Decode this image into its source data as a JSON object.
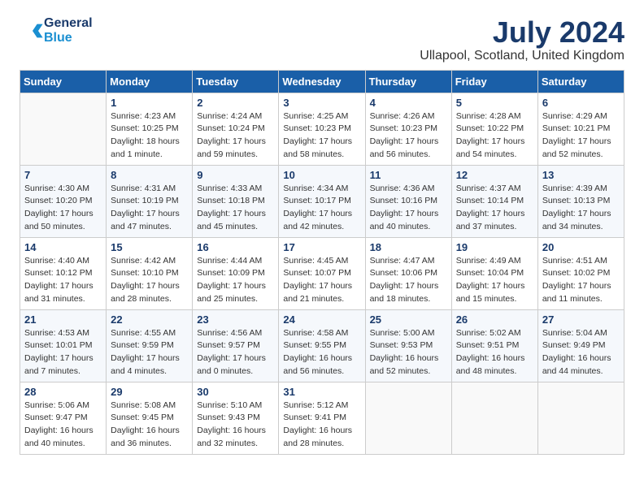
{
  "header": {
    "logo_general": "General",
    "logo_blue": "Blue",
    "month_title": "July 2024",
    "location": "Ullapool, Scotland, United Kingdom"
  },
  "days_of_week": [
    "Sunday",
    "Monday",
    "Tuesday",
    "Wednesday",
    "Thursday",
    "Friday",
    "Saturday"
  ],
  "weeks": [
    [
      {
        "day": "",
        "info": ""
      },
      {
        "day": "1",
        "info": "Sunrise: 4:23 AM\nSunset: 10:25 PM\nDaylight: 18 hours\nand 1 minute."
      },
      {
        "day": "2",
        "info": "Sunrise: 4:24 AM\nSunset: 10:24 PM\nDaylight: 17 hours\nand 59 minutes."
      },
      {
        "day": "3",
        "info": "Sunrise: 4:25 AM\nSunset: 10:23 PM\nDaylight: 17 hours\nand 58 minutes."
      },
      {
        "day": "4",
        "info": "Sunrise: 4:26 AM\nSunset: 10:23 PM\nDaylight: 17 hours\nand 56 minutes."
      },
      {
        "day": "5",
        "info": "Sunrise: 4:28 AM\nSunset: 10:22 PM\nDaylight: 17 hours\nand 54 minutes."
      },
      {
        "day": "6",
        "info": "Sunrise: 4:29 AM\nSunset: 10:21 PM\nDaylight: 17 hours\nand 52 minutes."
      }
    ],
    [
      {
        "day": "7",
        "info": "Sunrise: 4:30 AM\nSunset: 10:20 PM\nDaylight: 17 hours\nand 50 minutes."
      },
      {
        "day": "8",
        "info": "Sunrise: 4:31 AM\nSunset: 10:19 PM\nDaylight: 17 hours\nand 47 minutes."
      },
      {
        "day": "9",
        "info": "Sunrise: 4:33 AM\nSunset: 10:18 PM\nDaylight: 17 hours\nand 45 minutes."
      },
      {
        "day": "10",
        "info": "Sunrise: 4:34 AM\nSunset: 10:17 PM\nDaylight: 17 hours\nand 42 minutes."
      },
      {
        "day": "11",
        "info": "Sunrise: 4:36 AM\nSunset: 10:16 PM\nDaylight: 17 hours\nand 40 minutes."
      },
      {
        "day": "12",
        "info": "Sunrise: 4:37 AM\nSunset: 10:14 PM\nDaylight: 17 hours\nand 37 minutes."
      },
      {
        "day": "13",
        "info": "Sunrise: 4:39 AM\nSunset: 10:13 PM\nDaylight: 17 hours\nand 34 minutes."
      }
    ],
    [
      {
        "day": "14",
        "info": "Sunrise: 4:40 AM\nSunset: 10:12 PM\nDaylight: 17 hours\nand 31 minutes."
      },
      {
        "day": "15",
        "info": "Sunrise: 4:42 AM\nSunset: 10:10 PM\nDaylight: 17 hours\nand 28 minutes."
      },
      {
        "day": "16",
        "info": "Sunrise: 4:44 AM\nSunset: 10:09 PM\nDaylight: 17 hours\nand 25 minutes."
      },
      {
        "day": "17",
        "info": "Sunrise: 4:45 AM\nSunset: 10:07 PM\nDaylight: 17 hours\nand 21 minutes."
      },
      {
        "day": "18",
        "info": "Sunrise: 4:47 AM\nSunset: 10:06 PM\nDaylight: 17 hours\nand 18 minutes."
      },
      {
        "day": "19",
        "info": "Sunrise: 4:49 AM\nSunset: 10:04 PM\nDaylight: 17 hours\nand 15 minutes."
      },
      {
        "day": "20",
        "info": "Sunrise: 4:51 AM\nSunset: 10:02 PM\nDaylight: 17 hours\nand 11 minutes."
      }
    ],
    [
      {
        "day": "21",
        "info": "Sunrise: 4:53 AM\nSunset: 10:01 PM\nDaylight: 17 hours\nand 7 minutes."
      },
      {
        "day": "22",
        "info": "Sunrise: 4:55 AM\nSunset: 9:59 PM\nDaylight: 17 hours\nand 4 minutes."
      },
      {
        "day": "23",
        "info": "Sunrise: 4:56 AM\nSunset: 9:57 PM\nDaylight: 17 hours\nand 0 minutes."
      },
      {
        "day": "24",
        "info": "Sunrise: 4:58 AM\nSunset: 9:55 PM\nDaylight: 16 hours\nand 56 minutes."
      },
      {
        "day": "25",
        "info": "Sunrise: 5:00 AM\nSunset: 9:53 PM\nDaylight: 16 hours\nand 52 minutes."
      },
      {
        "day": "26",
        "info": "Sunrise: 5:02 AM\nSunset: 9:51 PM\nDaylight: 16 hours\nand 48 minutes."
      },
      {
        "day": "27",
        "info": "Sunrise: 5:04 AM\nSunset: 9:49 PM\nDaylight: 16 hours\nand 44 minutes."
      }
    ],
    [
      {
        "day": "28",
        "info": "Sunrise: 5:06 AM\nSunset: 9:47 PM\nDaylight: 16 hours\nand 40 minutes."
      },
      {
        "day": "29",
        "info": "Sunrise: 5:08 AM\nSunset: 9:45 PM\nDaylight: 16 hours\nand 36 minutes."
      },
      {
        "day": "30",
        "info": "Sunrise: 5:10 AM\nSunset: 9:43 PM\nDaylight: 16 hours\nand 32 minutes."
      },
      {
        "day": "31",
        "info": "Sunrise: 5:12 AM\nSunset: 9:41 PM\nDaylight: 16 hours\nand 28 minutes."
      },
      {
        "day": "",
        "info": ""
      },
      {
        "day": "",
        "info": ""
      },
      {
        "day": "",
        "info": ""
      }
    ]
  ]
}
